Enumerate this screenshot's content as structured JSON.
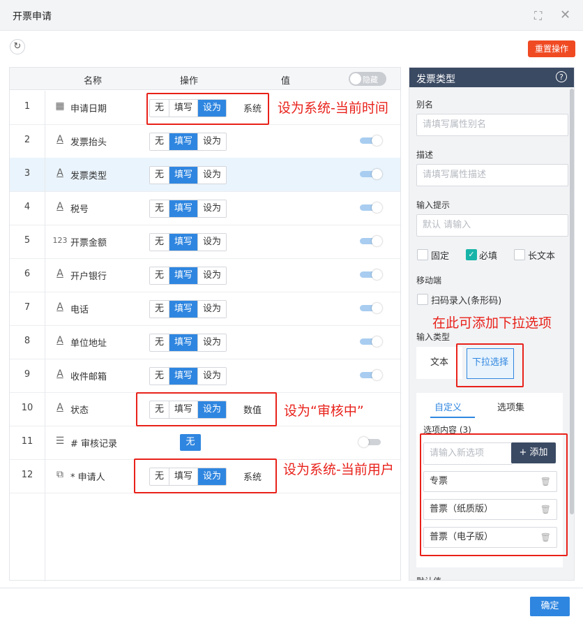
{
  "window": {
    "title": "开票申请"
  },
  "toolbar": {
    "reset_label": "重置操作"
  },
  "table": {
    "headers": {
      "name": "名称",
      "action": "操作",
      "value": "值"
    },
    "hide_toggle_label": "隐藏",
    "rows": [
      {
        "num": "1",
        "icon": "calendar-icon",
        "name": "申请日期",
        "seg": [
          "无",
          "填写",
          "设为"
        ],
        "active": 2,
        "value": "系统",
        "toggle": "none"
      },
      {
        "num": "2",
        "icon": "text-field-icon",
        "name": "发票抬头",
        "seg": [
          "无",
          "填写",
          "设为"
        ],
        "active": 1,
        "value": "",
        "toggle": "on"
      },
      {
        "num": "3",
        "icon": "text-field-icon",
        "name": "发票类型",
        "seg": [
          "无",
          "填写",
          "设为"
        ],
        "active": 1,
        "value": "",
        "toggle": "on"
      },
      {
        "num": "4",
        "icon": "text-field-icon",
        "name": "税号",
        "seg": [
          "无",
          "填写",
          "设为"
        ],
        "active": 1,
        "value": "",
        "toggle": "on"
      },
      {
        "num": "5",
        "icon": "number-field-icon",
        "name": "开票金额",
        "seg": [
          "无",
          "填写",
          "设为"
        ],
        "active": 1,
        "value": "",
        "toggle": "on"
      },
      {
        "num": "6",
        "icon": "text-field-icon",
        "name": "开户银行",
        "seg": [
          "无",
          "填写",
          "设为"
        ],
        "active": 1,
        "value": "",
        "toggle": "on"
      },
      {
        "num": "7",
        "icon": "text-field-icon",
        "name": "电话",
        "seg": [
          "无",
          "填写",
          "设为"
        ],
        "active": 1,
        "value": "",
        "toggle": "on"
      },
      {
        "num": "8",
        "icon": "text-field-icon",
        "name": "单位地址",
        "seg": [
          "无",
          "填写",
          "设为"
        ],
        "active": 1,
        "value": "",
        "toggle": "on"
      },
      {
        "num": "9",
        "icon": "text-field-icon",
        "name": "收件邮箱",
        "seg": [
          "无",
          "填写",
          "设为"
        ],
        "active": 1,
        "value": "",
        "toggle": "on"
      },
      {
        "num": "10",
        "icon": "text-field-icon",
        "name": "状态",
        "seg": [
          "无",
          "填写",
          "设为"
        ],
        "active": 2,
        "value": "数值",
        "toggle": "none"
      },
      {
        "num": "11",
        "icon": "list-icon",
        "name": "# 审核记录",
        "seg": [
          "无"
        ],
        "active": 0,
        "value": "",
        "toggle": "off"
      },
      {
        "num": "12",
        "icon": "user-link-icon",
        "name": "* 申请人",
        "seg": [
          "无",
          "填写",
          "设为"
        ],
        "active": 2,
        "value": "系统",
        "toggle": "none"
      }
    ]
  },
  "annotations": {
    "row1": "设为系统-当前时间",
    "row10": "设为“审核中”",
    "row12": "设为系统-当前用户",
    "dropdown": "在此可添加下拉选项"
  },
  "panel": {
    "title": "发票类型",
    "alias_label": "别名",
    "alias_placeholder": "请填写属性别名",
    "desc_label": "描述",
    "desc_placeholder": "请填写属性描述",
    "hint_label": "输入提示",
    "hint_placeholder": "默认 请输入",
    "check_fixed": "固定",
    "check_required": "必填",
    "check_longtext": "长文本",
    "mobile_label": "移动端",
    "scan_label": "扫码录入(条形码)",
    "input_type_label": "输入类型",
    "type_text": "文本",
    "type_dropdown": "下拉选择",
    "tab_custom": "自定义",
    "tab_optionset": "选项集",
    "options_label": "选项内容 (3)",
    "new_option_placeholder": "请输入新选项",
    "add_label": "+ 添加",
    "options": [
      "专票",
      "普票（纸质版）",
      "普票（电子版）"
    ],
    "default_label": "默认值"
  },
  "footer": {
    "confirm_label": "确定"
  },
  "colors": {
    "accent": "#2f86e0",
    "danger": "#f04a23",
    "annotation": "#e8211a",
    "panel_header": "#3b4a63",
    "check": "#18b4a9"
  }
}
